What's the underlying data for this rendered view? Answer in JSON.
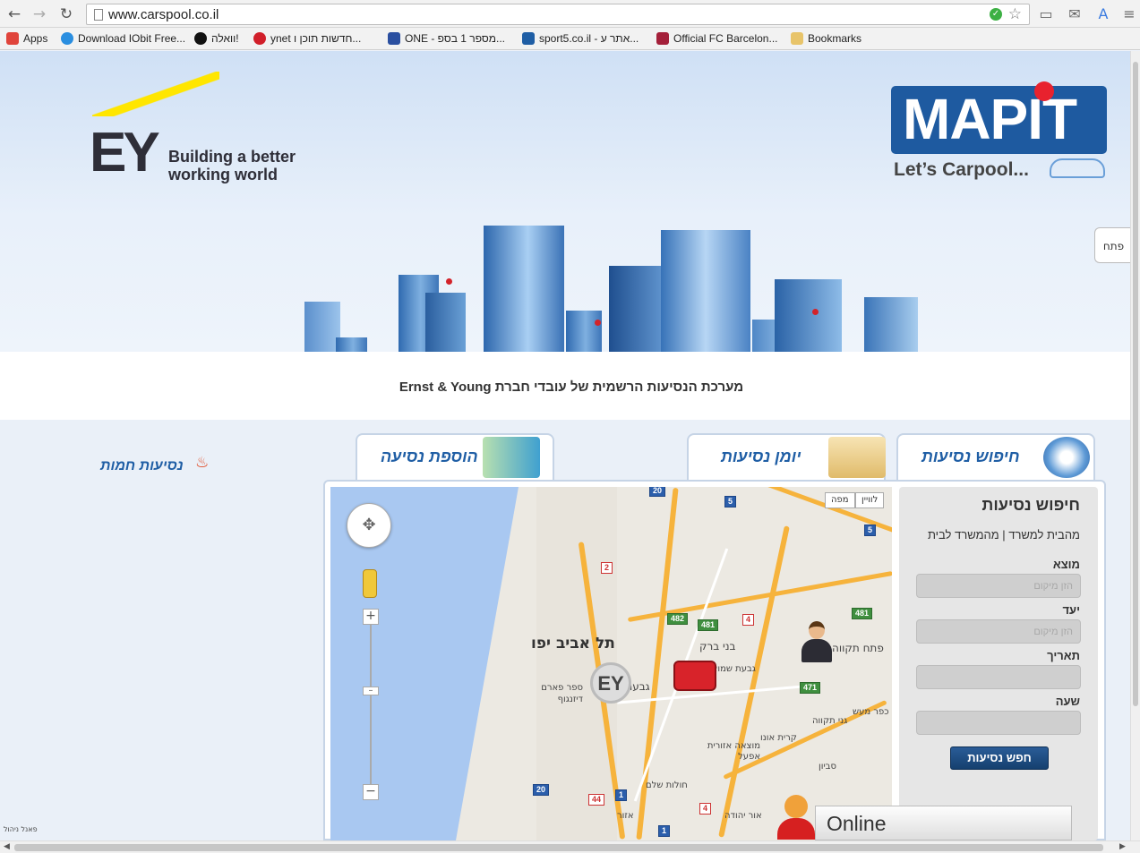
{
  "browser": {
    "url": "www.carspool.co.il",
    "bookmarks": [
      {
        "label": "Apps",
        "color": "#e0443b"
      },
      {
        "label": "Download IObit Free...",
        "color": "#2a8ee0"
      },
      {
        "label": "וואלה!",
        "color": "#111111"
      },
      {
        "label": "ynet חדשות תוכן ו...",
        "color": "#d11f2a"
      },
      {
        "label": "ONE - מספר 1 בספ...",
        "color": "#2a4fa0"
      },
      {
        "label": "sport5.co.il - אתר ע...",
        "color": "#1f5ea5"
      },
      {
        "label": "Official FC Barcelon...",
        "color": "#a4203a"
      },
      {
        "label": "Bookmarks",
        "color": "#e8c46a"
      }
    ]
  },
  "header": {
    "ey_letters": "EY",
    "ey_tagline_1": "Building a better",
    "ey_tagline_2": "working world",
    "mapit_logo": "MAPIT",
    "mapit_slogan": "Let’s Carpool...",
    "open_tab": "פתח"
  },
  "subtitle": "מערכת הנסיעות הרשמית של עובדי חברת Ernst & Young",
  "hot_rides": "נסיעות חמות",
  "tabs": {
    "search": "חיפוש נסיעות",
    "journal": "יומן נסיעות",
    "add": "הוספת נסיעה"
  },
  "map": {
    "map_type_map": "מפה",
    "map_type_satellite": "לוויין",
    "cities": {
      "tel_aviv": "תל אביב יפו",
      "bnei_brak": "בני ברק",
      "givatayim": "גבעתיים",
      "petah_tikva": "פתח תקווה",
      "givat_shmuel": "גבעת שמואל",
      "ganei_tikva": "גני תקווה",
      "kiryat_ono": "קרית אונו",
      "savyon": "סביון",
      "or_yehuda": "אור יהודה",
      "kfar_maas": "כפר מעש",
      "sde_dov": "ספר פארם דיזנגוף",
      "azor": "אזור",
      "holon": "חולות שלם",
      "industrial": "מוצאה אזורית אפעל"
    },
    "shields": [
      "20",
      "5",
      "5",
      "2",
      "482",
      "481",
      "4",
      "481",
      "471",
      "20",
      "44",
      "1",
      "4",
      "1"
    ]
  },
  "search_form": {
    "title": "חיפוש נסיעות",
    "direction_links": "מהבית למשרד | מהמשרד לבית",
    "origin_label": "מוצא",
    "origin_placeholder": "הזן מיקום",
    "destination_label": "יעד",
    "destination_placeholder": "הזן מיקום",
    "date_label": "תאריך",
    "time_label": "שעה",
    "submit": "חפש נסיעות"
  },
  "online_chat": "Online",
  "admin_link": "פאנל ניהול"
}
